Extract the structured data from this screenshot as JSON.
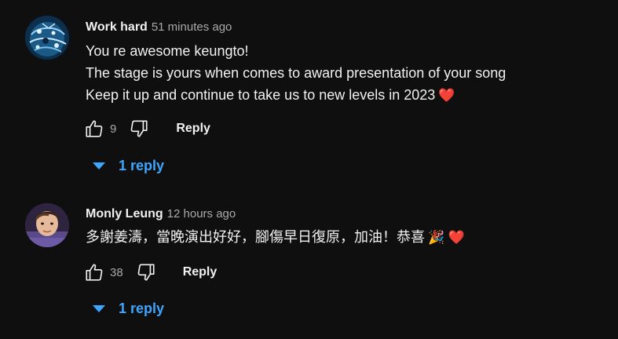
{
  "comments": [
    {
      "author": "Work hard",
      "time": "51 minutes ago",
      "avatar_icon": "patterned-globe-avatar",
      "lines": [
        "You re awesome keungto!",
        "The stage is yours when comes to award presentation of your song",
        "Keep it up and continue to take us to new levels in 2023"
      ],
      "end_emoji": "❤️",
      "likes": "9",
      "reply_label": "Reply",
      "replies_label": "1 reply"
    },
    {
      "author": "Monly Leung",
      "time": "12 hours ago",
      "avatar_icon": "person-photo-avatar",
      "lines": [
        "多謝姜濤，當晚演出好好，腳傷早日復原，加油！恭喜"
      ],
      "end_emoji": "🎉 ❤️",
      "likes": "38",
      "reply_label": "Reply",
      "replies_label": "1 reply"
    }
  ],
  "colors": {
    "background": "#0f0f0f",
    "text": "#f1f1f1",
    "secondary_text": "#aaaaaa",
    "link_blue": "#3ea6ff",
    "heart_red": "#e0252a"
  }
}
